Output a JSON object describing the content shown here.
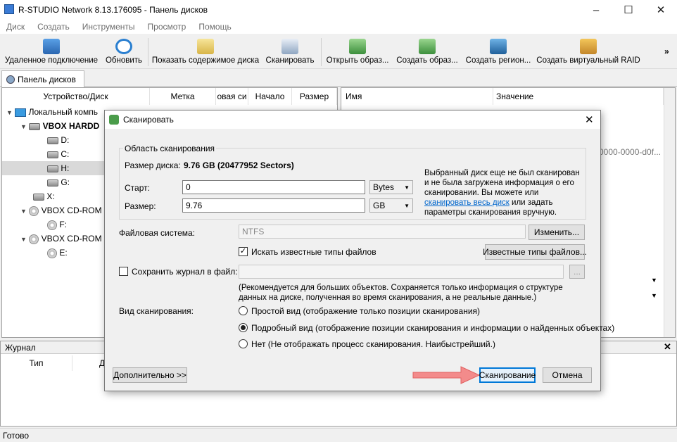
{
  "window": {
    "title": "R-STUDIO Network 8.13.176095 - Панель дисков"
  },
  "menu": [
    "Диск",
    "Создать",
    "Инструменты",
    "Просмотр",
    "Помощь"
  ],
  "toolbar": [
    {
      "label": "Удаленное подключение",
      "icon": "remote-connect-icon"
    },
    {
      "label": "Обновить",
      "icon": "refresh-icon"
    },
    {
      "label": "Показать содержимое диска",
      "icon": "show-content-icon"
    },
    {
      "label": "Сканировать",
      "icon": "scan-icon"
    },
    {
      "label": "Открыть образ...",
      "icon": "open-image-icon"
    },
    {
      "label": "Создать образ...",
      "icon": "create-image-icon"
    },
    {
      "label": "Создать регион...",
      "icon": "create-region-icon"
    },
    {
      "label": "Создать виртуальный RAID",
      "icon": "virtual-raid-icon"
    }
  ],
  "tab": {
    "label": "Панель дисков"
  },
  "left_panel": {
    "columns": [
      "Устройство/Диск",
      "Метка",
      "овая си",
      "Начало",
      "Размер"
    ],
    "rows": [
      "Локальный компь",
      "VBOX HARDD",
      "D:",
      "C:",
      "H:",
      "G:",
      "X:",
      "VBOX CD-ROM",
      "F:",
      "VBOX CD-ROM",
      "E:"
    ]
  },
  "right_panel": {
    "columns": [
      "Имя",
      "Значение"
    ],
    "visible_value_fragment": "0000-0000-d0f..."
  },
  "journal": {
    "title": "Журнал",
    "columns": [
      "Тип",
      "Д"
    ]
  },
  "status": {
    "text": "Готово"
  },
  "dialog": {
    "title": "Сканировать",
    "group_title": "Область сканирования",
    "disk_size_label": "Размер диска:",
    "disk_size_value": "9.76 GB (20477952 Sectors)",
    "start_label": "Старт:",
    "start_value": "0",
    "start_unit": "Bytes",
    "size_label": "Размер:",
    "size_value": "9.76",
    "size_unit": "GB",
    "info_text_1": "Выбранный диск еще не был сканирован и не была загружена информация о его сканировании. Вы можете или",
    "info_link": "сканировать весь диск",
    "info_text_2": "или задать параметры сканирования вручную.",
    "fs_label": "Файловая система:",
    "fs_value": "NTFS",
    "change_button": "Изменить...",
    "known_types_checkbox": "Искать известные типы файлов",
    "known_types_button": "Известные типы файлов...",
    "save_log_checkbox": "Сохранить журнал в файл:",
    "browse_button": "...",
    "log_note": "(Рекомендуется для больших объектов. Сохраняется только информация о структуре данных на диске, полученная во время сканирования, а не реальные данные.)",
    "view_label": "Вид сканирования:",
    "view_options": [
      "Простой вид (отображение только позиции сканирования)",
      "Подробный вид (отображение позиции сканирования и информации о найденных объектах)",
      "Нет (Не отображать процесс сканирования. Наибыстрейший.)"
    ],
    "selected_view": 1,
    "advanced_button": "Дополнительно >>",
    "scan_button": "Сканирование",
    "cancel_button": "Отмена"
  },
  "colors": {
    "accent_arrow": "#f38b8b",
    "link": "#0066cc",
    "focus": "#0078d7"
  }
}
